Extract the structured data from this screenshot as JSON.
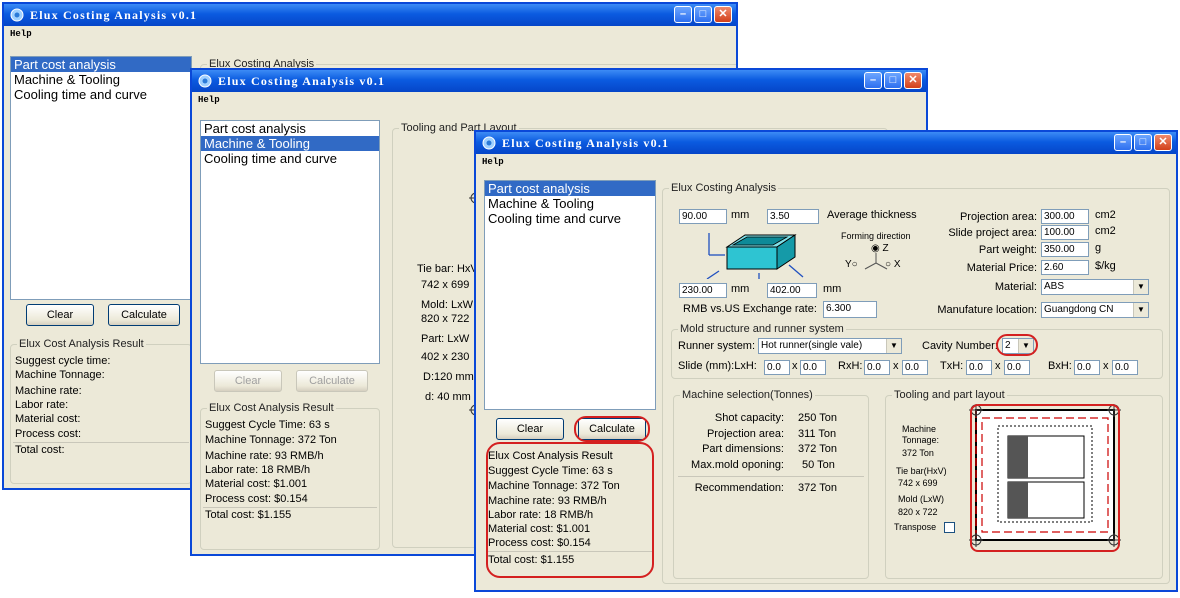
{
  "app": {
    "title": "Elux Costing Analysis v0.1",
    "menu_help": "Help"
  },
  "nav_items": [
    "Part cost analysis",
    "Machine & Tooling",
    "Cooling time and curve"
  ],
  "buttons": {
    "clear": "Clear",
    "calculate": "Calculate"
  },
  "groups": {
    "costing": "Elux Costing Analysis",
    "tooling_layout": "Tooling and Part Layout",
    "tooling_layout_lower": "Tooling and part layout",
    "mold": "Mold structure and runner system",
    "machine": "Machine selection(Tonnes)"
  },
  "window1": {
    "result_title": "Elux Cost Analysis Result",
    "result_lines": [
      "Suggest cycle time:",
      "Machine Tonnage:",
      "Machine rate:",
      "Labor rate:",
      "Material cost:",
      "Process cost:",
      "Total cost:"
    ]
  },
  "window2": {
    "tooling_lines": [
      "Tie bar: HxV",
      "742 x 699",
      "Mold: LxW",
      "820 x 722",
      "Part: LxW",
      "402 x 230",
      "D:120 mm",
      "d: 40 mm"
    ],
    "result_title": "Elux Cost Analysis Result",
    "result_lines": [
      "Suggest Cycle Time:  63 s",
      "Machine Tonnage: 372 Ton",
      "Machine rate:  93  RMB/h",
      "Labor rate: 18 RMB/h",
      "Material cost:  $1.001",
      "Process cost: $0.154",
      "Total cost:  $1.155"
    ]
  },
  "window3": {
    "dims": {
      "length": "90.00",
      "thickness": "3.50",
      "width": "230.00",
      "height": "402.00",
      "unit": "mm",
      "avg_thickness_label": "Average thickness"
    },
    "forming": {
      "label": "Forming direction",
      "z": "Z",
      "y": "Y",
      "x": "X"
    },
    "exchange": {
      "label": "RMB vs.US Exchange rate:",
      "value": "6.300"
    },
    "right_fields": [
      {
        "label": "Projection area:",
        "value": "300.00",
        "unit": "cm2"
      },
      {
        "label": "Slide project area:",
        "value": "100.00",
        "unit": "cm2"
      },
      {
        "label": "Part weight:",
        "value": "350.00",
        "unit": "g"
      },
      {
        "label": "Material Price:",
        "value": "2.60",
        "unit": "$/kg"
      }
    ],
    "material": {
      "label": "Material:",
      "value": "ABS"
    },
    "location": {
      "label": "Manufature location:",
      "value": "Guangdong CN"
    },
    "runner": {
      "label": "Runner system:",
      "value": "Hot runner(single vale)"
    },
    "cavity": {
      "label": "Cavity Number:",
      "value": "2"
    },
    "slide": {
      "label": "Slide (mm):LxH:",
      "lxh": [
        "0.0",
        "0.0"
      ],
      "rxh_label": "RxH:",
      "rxh": [
        "0.0",
        "0.0"
      ],
      "txh_label": "TxH:",
      "txh": [
        "0.0",
        "0.0"
      ],
      "bxh_label": "BxH:",
      "bxh": [
        "0.0",
        "0.0"
      ]
    },
    "machine": [
      {
        "label": "Shot capacity:",
        "value": "250 Ton"
      },
      {
        "label": "Projection area:",
        "value": "311 Ton"
      },
      {
        "label": "Part dimensions:",
        "value": "372 Ton"
      },
      {
        "label": "Max.mold oponing:",
        "value": "50 Ton"
      },
      {
        "label": "Recommendation:",
        "value": "372 Ton"
      }
    ],
    "tooling": {
      "machine_tonnage_label": "Machine Tonnage:",
      "machine_tonnage_value": "372 Ton",
      "tie_bar_label": "Tie bar(HxV)",
      "tie_bar_value": "742 x 699",
      "mold_label": "Mold (LxW)",
      "mold_value": "820 x 722",
      "transpose_label": "Transpose"
    },
    "result_title": "Elux Cost Analysis Result",
    "result_lines": [
      "Suggest Cycle Time:   63 s",
      "Machine Tonnage:  372  Ton",
      "Machine rate:  93  RMB/h",
      "Labor rate: 18 RMB/h",
      "Material cost:  $1.001",
      "Process cost: $0.154",
      "Total cost:  $1.155"
    ]
  }
}
